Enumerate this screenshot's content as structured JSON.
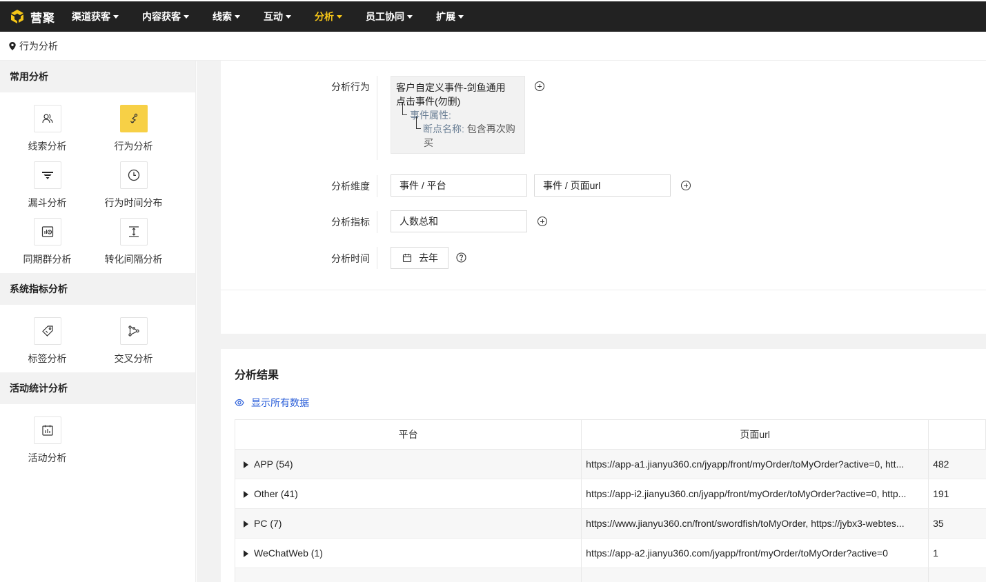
{
  "app": {
    "brand": "营聚",
    "accent": "#f5c518"
  },
  "nav": [
    {
      "label": "渠道获客",
      "active": false
    },
    {
      "label": "内容获客",
      "active": false
    },
    {
      "label": "线索",
      "active": false
    },
    {
      "label": "互动",
      "active": false
    },
    {
      "label": "分析",
      "active": true
    },
    {
      "label": "员工协同",
      "active": false
    },
    {
      "label": "扩展",
      "active": false
    }
  ],
  "breadcrumb": {
    "icon": "location-pin-icon",
    "label": "行为分析"
  },
  "sidebar": {
    "sections": [
      {
        "title": "常用分析",
        "items": [
          {
            "label": "线索分析",
            "icon": "user-group-icon"
          },
          {
            "label": "行为分析",
            "icon": "pointer-path-icon",
            "active": true
          },
          {
            "label": "漏斗分析",
            "icon": "funnel-icon"
          },
          {
            "label": "行为时间分布",
            "icon": "clock-icon"
          },
          {
            "label": "同期群分析",
            "icon": "cohort-chart-icon"
          },
          {
            "label": "转化间隔分析",
            "icon": "interval-icon"
          }
        ]
      },
      {
        "title": "系统指标分析",
        "items": [
          {
            "label": "标签分析",
            "icon": "tag-icon"
          },
          {
            "label": "交叉分析",
            "icon": "cross-nodes-icon"
          }
        ]
      },
      {
        "title": "活动统计分析",
        "items": [
          {
            "label": "活动分析",
            "icon": "calendar-chart-icon"
          }
        ]
      }
    ]
  },
  "config": {
    "behavior": {
      "label": "分析行为",
      "event_line1": "客户自定义事件-剑鱼通用",
      "event_line2": "点击事件(勿删)",
      "attr_label": "事件属性:",
      "cond_key": "断点名称:",
      "cond_value_line1": "包含再次购",
      "cond_value_line2": "买"
    },
    "dimension": {
      "label": "分析维度",
      "values": [
        "事件 / 平台",
        "事件 / 页面url"
      ]
    },
    "metric": {
      "label": "分析指标",
      "value": "人数总和"
    },
    "time": {
      "label": "分析时间",
      "value": "去年"
    }
  },
  "results": {
    "title": "分析结果",
    "show_all": "显示所有数据",
    "columns": [
      "平台",
      "页面url"
    ],
    "rows": [
      {
        "platform": "APP (54)",
        "url": "https://app-a1.jianyu360.cn/jyapp/front/myOrder/toMyOrder?active=0, htt...",
        "value": "482"
      },
      {
        "platform": "Other (41)",
        "url": "https://app-i2.jianyu360.cn/jyapp/front/myOrder/toMyOrder?active=0, http...",
        "value": "191"
      },
      {
        "platform": "PC (7)",
        "url": "https://www.jianyu360.cn/front/swordfish/toMyOrder, https://jybx3-webtes...",
        "value": "35"
      },
      {
        "platform": "WeChatWeb (1)",
        "url": "https://app-a2.jianyu360.com/jyapp/front/myOrder/toMyOrder?active=0",
        "value": "1"
      }
    ]
  }
}
